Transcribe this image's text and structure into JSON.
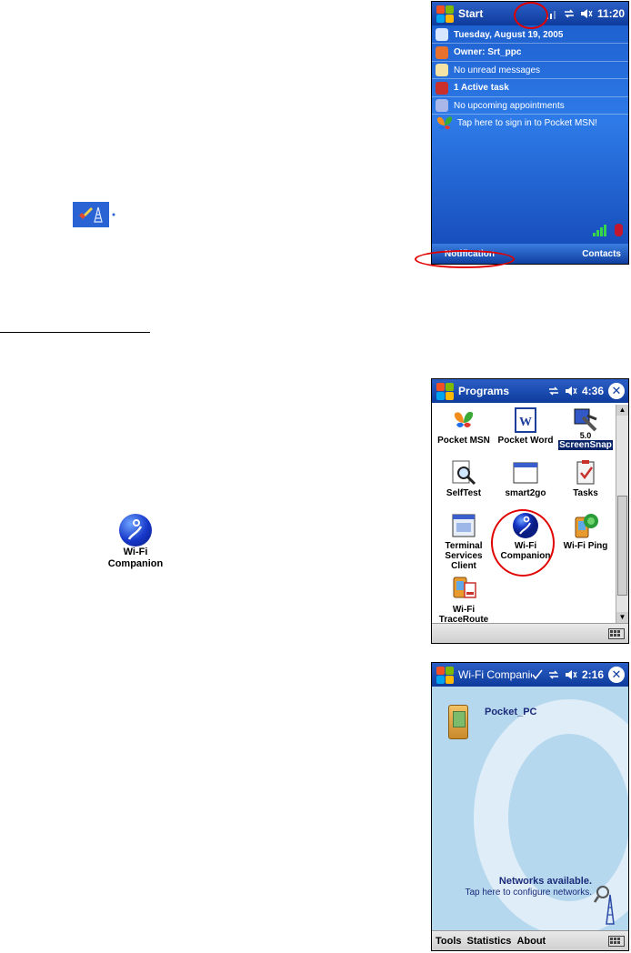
{
  "today_screen": {
    "start_label": "Start",
    "time": "11:20",
    "rows": [
      {
        "text": "Tuesday, August 19, 2005",
        "bold": true,
        "icon": "calendar-clock-icon",
        "color": "#d9e6ff"
      },
      {
        "text": "Owner: Srt_ppc",
        "bold": true,
        "icon": "owner-person-icon",
        "color": "#e8712d"
      },
      {
        "text": "No unread messages",
        "bold": false,
        "icon": "mail-icon",
        "color": "#f4e3a4"
      },
      {
        "text": "1 Active task",
        "bold": true,
        "icon": "task-icon",
        "color": "#c9302c"
      },
      {
        "text": "No upcoming appointments",
        "bold": false,
        "icon": "calendar-icon",
        "color": "#a9b7e8"
      }
    ],
    "msn_text": "Tap here to sign in to Pocket MSN!",
    "softkey_left": "Notification",
    "softkey_right": "Contacts"
  },
  "programs_screen": {
    "title": "Programs",
    "time": "4:36",
    "programs": [
      {
        "label": "Pocket MSN",
        "icon": "msn-butterfly-icon",
        "selected": false
      },
      {
        "label": "Pocket Word",
        "icon": "word-document-icon",
        "selected": false
      },
      {
        "label": "ScreenSnap",
        "icon": "screensnap-icon",
        "selected": true,
        "badge": "5.0"
      },
      {
        "label": "SelfTest",
        "icon": "selftest-magnifier-icon",
        "selected": false
      },
      {
        "label": "smart2go",
        "icon": "window-icon",
        "selected": false
      },
      {
        "label": "Tasks",
        "icon": "tasks-clipboard-icon",
        "selected": false
      },
      {
        "label": "Terminal Services Client",
        "icon": "terminal-services-icon",
        "selected": false
      },
      {
        "label": "Wi-Fi Companion",
        "icon": "wifi-companion-icon",
        "selected": false
      },
      {
        "label": "Wi-Fi Ping",
        "icon": "wifi-ping-icon",
        "selected": false
      },
      {
        "label": "Wi-Fi TraceRoute",
        "icon": "wifi-traceroute-icon",
        "selected": false
      }
    ]
  },
  "wifi_icon_label": "Wi-Fi Companion",
  "wifi_screen": {
    "title": "Wi-Fi Companion",
    "time": "2:16",
    "device_label": "Pocket_PC",
    "networks_available": "Networks available.",
    "configure_hint": "Tap here to configure networks.",
    "menu": [
      "Tools",
      "Statistics",
      "About"
    ]
  },
  "colors": {
    "annotation_red": "#e00000",
    "title_blue": "#0e3b9c",
    "selection_navy": "#0a246a"
  }
}
